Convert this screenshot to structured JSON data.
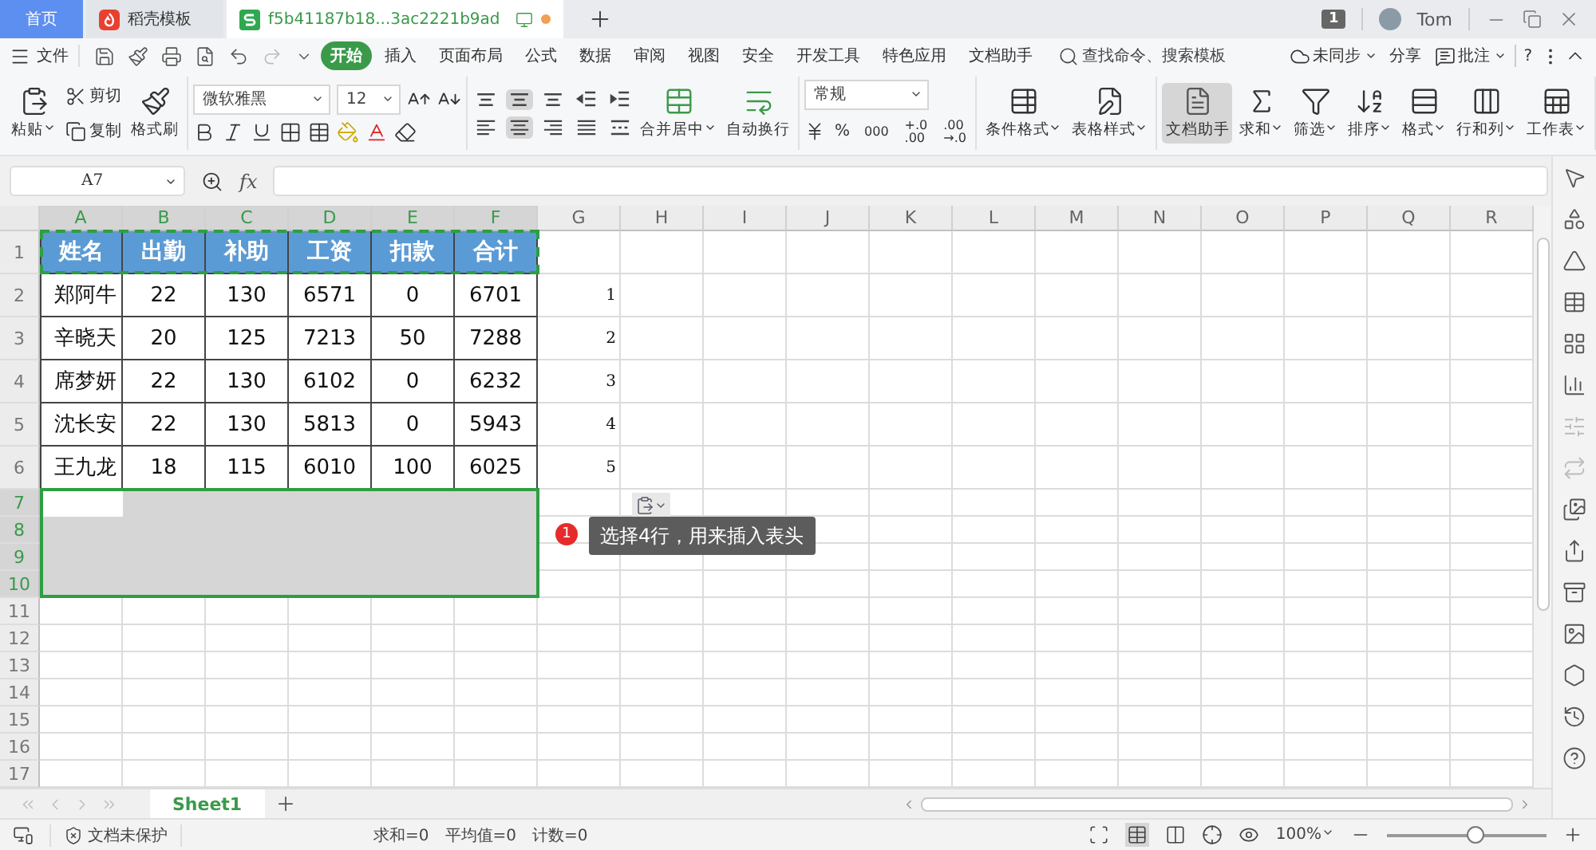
{
  "tabs": [
    {
      "kind": "home",
      "label": "首页",
      "selected": false,
      "unsaved": false
    },
    {
      "kind": "docer",
      "label": "稻壳模板",
      "selected": false,
      "unsaved": false
    },
    {
      "kind": "sheet",
      "label": "f5b41187b18...3ac2221b9ad",
      "selected": true,
      "unsaved": true
    }
  ],
  "window": {
    "badge": "1",
    "user": "Tom"
  },
  "menu": {
    "file": "文件",
    "items": [
      {
        "label": "开始",
        "selected": true
      },
      {
        "label": "插入",
        "selected": false
      },
      {
        "label": "页面布局",
        "selected": false
      },
      {
        "label": "公式",
        "selected": false
      },
      {
        "label": "数据",
        "selected": false
      },
      {
        "label": "审阅",
        "selected": false
      },
      {
        "label": "视图",
        "selected": false
      },
      {
        "label": "安全",
        "selected": false
      },
      {
        "label": "开发工具",
        "selected": false
      },
      {
        "label": "特色应用",
        "selected": false
      },
      {
        "label": "文档助手",
        "selected": false
      }
    ],
    "search": "查找命令、搜索模板",
    "sync": "未同步",
    "share": "分享",
    "comment": "批注",
    "help": "?"
  },
  "ribbon": {
    "paste": "粘贴",
    "cut": "剪切",
    "copy": "复制",
    "painter": "格式刷",
    "font": "微软雅黑",
    "font_size": "12",
    "align": [
      {
        "kind": "top",
        "selected": false
      },
      {
        "kind": "middle",
        "selected": true
      },
      {
        "kind": "bottom",
        "selected": false
      },
      {
        "kind": "outdent",
        "selected": false
      },
      {
        "kind": "indent",
        "selected": false
      },
      {
        "kind": "left",
        "selected": false
      },
      {
        "kind": "center",
        "selected": true
      },
      {
        "kind": "right",
        "selected": false
      },
      {
        "kind": "justify",
        "selected": false
      },
      {
        "kind": "distributed",
        "selected": false
      }
    ],
    "merge": "合并居中",
    "wrap": "自动换行",
    "number_format": "常规",
    "percent": "%",
    "thousands": "000",
    "add_decimal": [
      "+.0",
      ".00"
    ],
    "remove_decimal": [
      ".00",
      "→.0"
    ],
    "tools": [
      {
        "kind": "cond",
        "label": "条件格式",
        "selected": false,
        "dropdown": true
      },
      {
        "kind": "style",
        "label": "表格样式",
        "selected": false,
        "dropdown": true
      },
      {
        "kind": "assistant",
        "label": "文档助手",
        "selected": true,
        "dropdown": false
      },
      {
        "kind": "sum",
        "label": "求和",
        "selected": false,
        "dropdown": true
      },
      {
        "kind": "filter",
        "label": "筛选",
        "selected": false,
        "dropdown": true
      },
      {
        "kind": "sort",
        "label": "排序",
        "selected": false,
        "dropdown": true
      },
      {
        "kind": "format",
        "label": "格式",
        "selected": false,
        "dropdown": true
      },
      {
        "kind": "rowcol",
        "label": "行和列",
        "selected": false,
        "dropdown": true
      },
      {
        "kind": "sheet",
        "label": "工作表",
        "selected": false,
        "dropdown": true
      }
    ]
  },
  "formula_bar": {
    "cell": "A7",
    "fx": "fx"
  },
  "sheet": {
    "columns": [
      {
        "label": "A",
        "selected": true
      },
      {
        "label": "B",
        "selected": true
      },
      {
        "label": "C",
        "selected": true
      },
      {
        "label": "D",
        "selected": true
      },
      {
        "label": "E",
        "selected": true
      },
      {
        "label": "F",
        "selected": true
      },
      {
        "label": "G",
        "selected": false
      },
      {
        "label": "H",
        "selected": false
      },
      {
        "label": "I",
        "selected": false
      },
      {
        "label": "J",
        "selected": false
      },
      {
        "label": "K",
        "selected": false
      },
      {
        "label": "L",
        "selected": false
      },
      {
        "label": "M",
        "selected": false
      },
      {
        "label": "N",
        "selected": false
      },
      {
        "label": "O",
        "selected": false
      },
      {
        "label": "P",
        "selected": false
      },
      {
        "label": "Q",
        "selected": false
      },
      {
        "label": "R",
        "selected": false
      }
    ],
    "rows": [
      {
        "number": "1",
        "kind": "header",
        "selected": false,
        "copied": true,
        "active": false,
        "cells": [
          "姓名",
          "出勤",
          "补助",
          "工资",
          "扣款",
          "合计"
        ]
      },
      {
        "number": "2",
        "kind": "data",
        "selected": false,
        "copied": false,
        "active": false,
        "cells": [
          "郑阿牛",
          "22",
          "130",
          "6571",
          "0",
          "6701"
        ],
        "extra": "1"
      },
      {
        "number": "3",
        "kind": "data",
        "selected": false,
        "copied": false,
        "active": false,
        "cells": [
          "辛晓天",
          "20",
          "125",
          "7213",
          "50",
          "7288"
        ],
        "extra": "2"
      },
      {
        "number": "4",
        "kind": "data",
        "selected": false,
        "copied": false,
        "active": false,
        "cells": [
          "席梦妍",
          "22",
          "130",
          "6102",
          "0",
          "6232"
        ],
        "extra": "3"
      },
      {
        "number": "5",
        "kind": "data",
        "selected": false,
        "copied": false,
        "active": false,
        "cells": [
          "沈长安",
          "22",
          "130",
          "5813",
          "0",
          "5943"
        ],
        "extra": "4"
      },
      {
        "number": "6",
        "kind": "data",
        "selected": false,
        "copied": false,
        "active": false,
        "cells": [
          "王九龙",
          "18",
          "115",
          "6010",
          "100",
          "6025"
        ],
        "extra": "5"
      },
      {
        "number": "7",
        "kind": "blank",
        "selected": true,
        "copied": false,
        "active": true
      },
      {
        "number": "8",
        "kind": "blank",
        "selected": true,
        "copied": false,
        "active": false
      },
      {
        "number": "9",
        "kind": "blank",
        "selected": true,
        "copied": false,
        "active": false
      },
      {
        "number": "10",
        "kind": "blank",
        "selected": true,
        "copied": false,
        "active": false
      },
      {
        "number": "11",
        "kind": "blank",
        "selected": false,
        "copied": false,
        "active": false
      },
      {
        "number": "12",
        "kind": "blank",
        "selected": false,
        "copied": false,
        "active": false
      },
      {
        "number": "13",
        "kind": "blank",
        "selected": false,
        "copied": false,
        "active": false
      },
      {
        "number": "14",
        "kind": "blank",
        "selected": false,
        "copied": false,
        "active": false
      },
      {
        "number": "15",
        "kind": "blank",
        "selected": false,
        "copied": false,
        "active": false
      },
      {
        "number": "16",
        "kind": "blank",
        "selected": false,
        "copied": false,
        "active": false
      },
      {
        "number": "17",
        "kind": "blank",
        "selected": false,
        "copied": false,
        "active": false
      }
    ]
  },
  "tooltip": {
    "step": "1",
    "text": "选择4行，用来插入表头"
  },
  "sheet_tabs": [
    {
      "label": "Sheet1",
      "selected": true
    }
  ],
  "status": {
    "protection": "文档未保护",
    "sum": "求和=0",
    "average": "平均值=0",
    "count": "计数=0",
    "zoom": "100%",
    "zoom_slider": {
      "level": 0.55
    }
  }
}
